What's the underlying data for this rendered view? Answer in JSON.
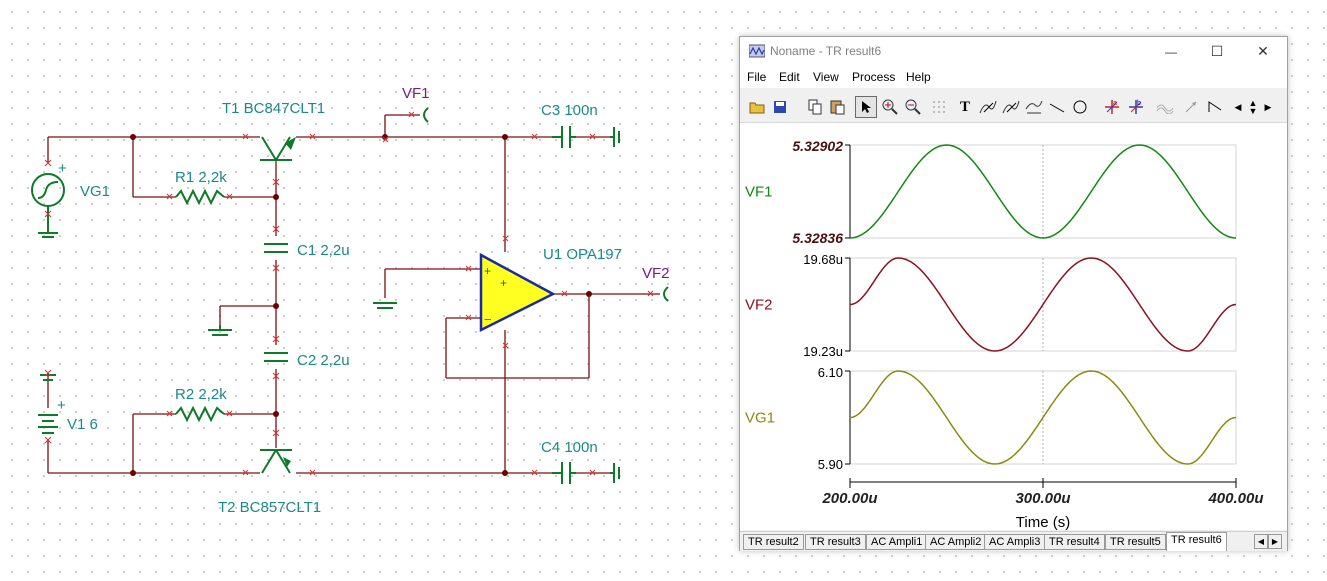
{
  "schematic": {
    "components": {
      "t1": "T1 BC847CLT1",
      "t2": "T2 BC857CLT1",
      "r1": "R1 2,2k",
      "r2": "R2 2,2k",
      "c1": "C1 2,2u",
      "c2": "C2 2,2u",
      "c3": "C3 100n",
      "c4": "C4 100n",
      "u1": "U1 OPA197",
      "vg1": "VG1",
      "v1": "V1 6"
    },
    "nets": {
      "vf1": "VF1",
      "vf2": "VF2"
    },
    "signs": {
      "plus": "+",
      "minus": "−",
      "v1_plus": "+",
      "vg1_plus": "+"
    }
  },
  "window": {
    "title": "Noname - TR result6",
    "controls": {
      "minimize": "—",
      "maximize": "☐",
      "close": "✕"
    },
    "menu": [
      "File",
      "Edit",
      "View",
      "Process",
      "Help"
    ],
    "toolbar_icons": [
      "open-icon",
      "save-icon",
      "copy-icon",
      "paste-icon",
      "pointer-icon",
      "zoom-in-icon",
      "zoom-out-icon",
      "grid-icon",
      "text-icon",
      "cursor-a-icon",
      "cursor-b-icon",
      "cursor-both-icon",
      "line-icon",
      "circle-icon",
      "marker-a-icon",
      "marker-b-icon",
      "waves-icon",
      "arrow-icon",
      "step-icon",
      "scroll-left-icon",
      "scroll-updown-icon",
      "scroll-right-icon"
    ],
    "tabs": [
      "TR result2",
      "TR result3",
      "AC Ampli1",
      "AC Ampli2",
      "AC Ampli3",
      "TR result4",
      "TR result5",
      "TR result6"
    ],
    "active_tab": "TR result6",
    "tab_scroll": {
      "left": "◀",
      "right": "▶"
    }
  },
  "chart_data": {
    "type": "line",
    "xlabel": "Time (s)",
    "x_ticks": [
      "200.00u",
      "300.00u",
      "400.00u"
    ],
    "xlim": [
      0.0002,
      0.0004
    ],
    "grid": "dotted vertical line at 300u",
    "series": [
      {
        "name": "VF1",
        "color": "#118811",
        "ylim": [
          5.32836,
          5.32902
        ],
        "y_ticks": [
          "5.32902",
          "5.32836"
        ],
        "x": [
          0.0002,
          0.00025,
          0.0003,
          0.00035,
          0.0004
        ],
        "y": [
          5.32836,
          5.32902,
          5.32836,
          5.32902,
          5.32836
        ]
      },
      {
        "name": "VF2",
        "color": "#8b1020",
        "ylim": [
          1.923e-05,
          1.968e-05
        ],
        "y_ticks": [
          "19.68u",
          "19.23u"
        ],
        "x": [
          0.0002,
          0.000225,
          0.000275,
          0.000325,
          0.000375,
          0.0004
        ],
        "y": [
          1.9455e-05,
          1.968e-05,
          1.923e-05,
          1.968e-05,
          1.923e-05,
          1.9455e-05
        ]
      },
      {
        "name": "VG1",
        "color": "#8a8a10",
        "ylim": [
          5.9,
          6.1
        ],
        "y_ticks": [
          "6.10",
          "5.90"
        ],
        "x": [
          0.0002,
          0.000225,
          0.000275,
          0.000325,
          0.000375,
          0.0004
        ],
        "y": [
          6.0,
          6.1,
          5.9,
          6.1,
          5.9,
          6.0
        ]
      }
    ]
  }
}
